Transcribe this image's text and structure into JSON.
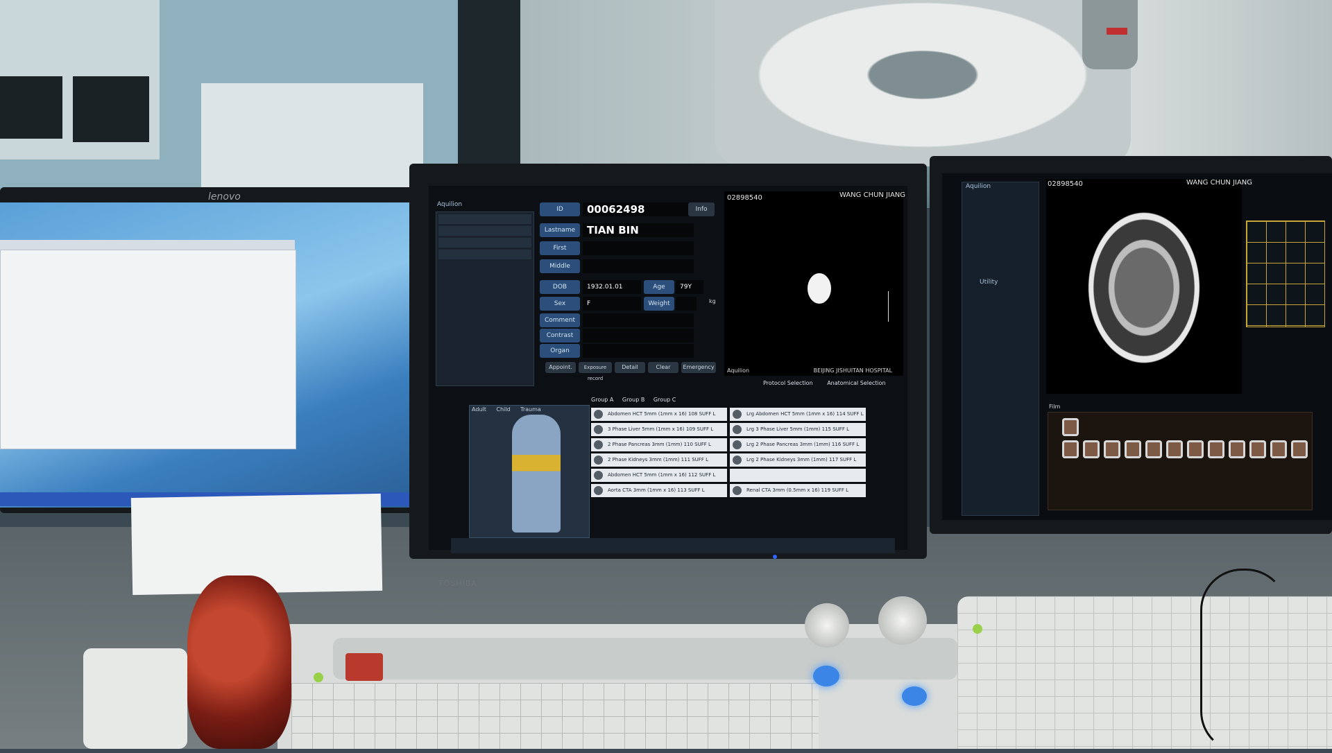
{
  "left_monitor": {
    "brand": "lenovo"
  },
  "center_monitor": {
    "brand": "TOSHIBA",
    "app": {
      "logo": "Aquilion",
      "patient": {
        "id_label": "ID",
        "id_value": "00062498",
        "info_button": "Info",
        "lastname_label": "Lastname",
        "lastname_value": "TIAN BIN",
        "first_label": "First",
        "middle_label": "Middle",
        "dob_label": "DOB",
        "dob_value": "1932.01.01",
        "age_label": "Age",
        "age_value": "79Y",
        "sex_label": "Sex",
        "sex_value": "F",
        "weight_label": "Weight",
        "weight_unit": "kg",
        "comment_label": "Comment",
        "contrast_label": "Contrast",
        "organ_label": "Organ"
      },
      "buttons": [
        "Appoint.",
        "Exposure record",
        "Detail",
        "Clear",
        "Emergency"
      ],
      "preview": {
        "id": "02898540",
        "name": "WANG CHUN JIANG",
        "hospital": "BEIJING JISHUITAN HOSPITAL",
        "footer_left": "Aquilion"
      },
      "selection_header": [
        "Protocol Selection",
        "Anatomical Selection"
      ],
      "patient_type_tabs": [
        "Adult",
        "Child",
        "Trauma"
      ],
      "group_tabs": [
        "Group A",
        "Group B",
        "Group C"
      ],
      "protocols": [
        {
          "name": "Abdomen HCT 5mm (1mm x 16)",
          "code": "108 SUFF L"
        },
        {
          "name": "Lrg Abdomen HCT 5mm (1mm x 16)",
          "code": "114 SUFF L"
        },
        {
          "name": "3 Phase Liver 5mm (1mm x 16)",
          "code": "109 SUFF L"
        },
        {
          "name": "Lrg 3 Phase Liver 5mm (1mm)",
          "code": "115 SUFF L"
        },
        {
          "name": "2 Phase Pancreas 3mm (1mm)",
          "code": "110 SUFF L"
        },
        {
          "name": "Lrg 2 Phase Pancreas 3mm (1mm)",
          "code": "116 SUFF L"
        },
        {
          "name": "2 Phase Kidneys 3mm (1mm)",
          "code": "111 SUFF L"
        },
        {
          "name": "Lrg 2 Phase Kidneys 3mm (1mm)",
          "code": "117 SUFF L"
        },
        {
          "name": "Abdomen HCT 5mm (1mm x 16)",
          "code": "112 SUFF L"
        },
        {
          "name": "",
          "code": ""
        },
        {
          "name": "Aorta CTA 3mm (1mm x 16)",
          "code": "113 SUFF L"
        },
        {
          "name": "Renal CTA 3mm (0.5mm x 16)",
          "code": "119 SUFF L"
        }
      ]
    }
  },
  "right_monitor": {
    "app": {
      "logo": "Aquilion",
      "image_id": "02898540",
      "image_name": "WANG CHUN JIANG",
      "utility_label": "Utility",
      "film_label": "Film"
    }
  },
  "colors": {
    "ui_label_blue": "#2b4f7a",
    "protocol_row_bg": "#e7ebef",
    "led_green": "#99d04a",
    "console_blue": "#3a85e6",
    "stop_red": "#b9392c"
  }
}
